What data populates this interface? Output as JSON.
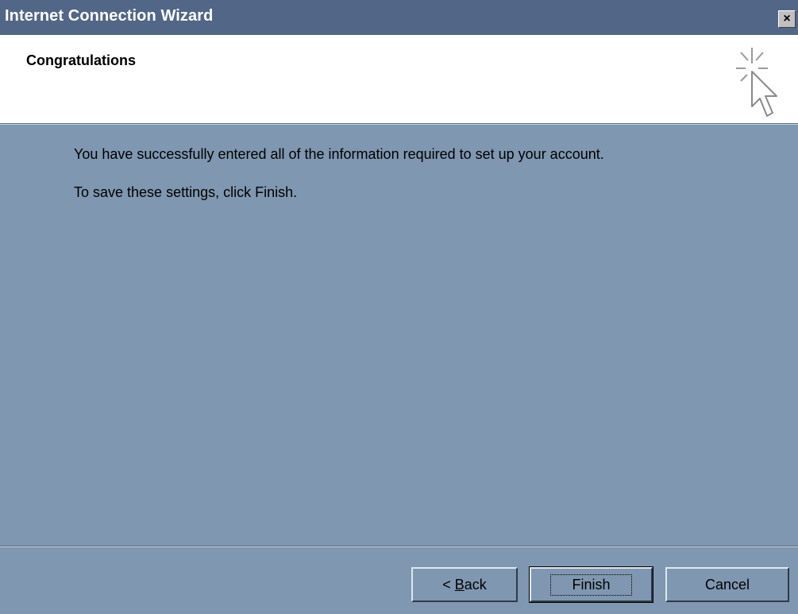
{
  "window": {
    "title": "Internet Connection Wizard",
    "close_symbol": "×"
  },
  "header": {
    "title": "Congratulations",
    "icon": "wizard-pointer-icon"
  },
  "body": {
    "line1": "You have successfully entered all of the information required to set up your account.",
    "line2": "To save these settings, click Finish."
  },
  "buttons": {
    "back_prefix": "< ",
    "back_mnemonic": "B",
    "back_rest": "ack",
    "finish": "Finish",
    "cancel": "Cancel"
  },
  "colors": {
    "titlebar": "#526787",
    "body_bg": "#7f97b0",
    "header_bg": "#ffffff"
  }
}
